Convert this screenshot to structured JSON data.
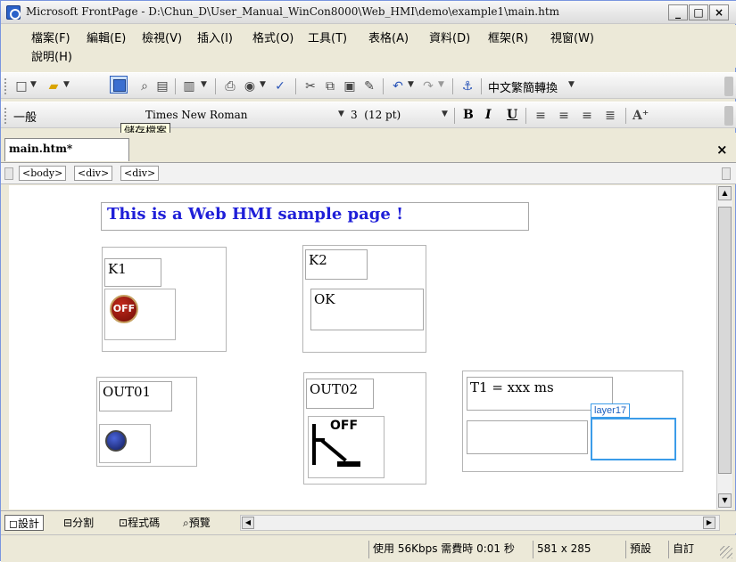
{
  "window": {
    "title": "Microsoft FrontPage - D:\\Chun_D\\User_Manual_WinCon8000\\Web_HMI\\demo\\example1\\main.htm",
    "controls": [
      "_",
      "□",
      "×"
    ]
  },
  "menu": {
    "items": [
      "檔案(F)",
      "編輯(E)",
      "檢視(V)",
      "插入(I)",
      "格式(O)",
      "工具(T)",
      "表格(A)",
      "資料(D)",
      "框架(R)",
      "視窗(W)",
      "說明(H)"
    ]
  },
  "toolbar_standard": {
    "convert_label": "中文繁簡轉換",
    "tooltip": "儲存檔案"
  },
  "toolbar_format": {
    "style": "一般",
    "font": "Times New Roman",
    "size": "3  (12 pt)",
    "bold": "B",
    "italic": "I",
    "underline": "U"
  },
  "doc_tabs": {
    "active": "main.htm*",
    "close": "×"
  },
  "tag_path": [
    "<body>",
    "<div>",
    "<div>"
  ],
  "design": {
    "heading": "This is a Web HMI sample page !",
    "k1_label": "K1",
    "k1_button_text": "OFF",
    "k2_label": "K2",
    "k2_value": "OK",
    "out01_label": "OUT01",
    "out02_label": "OUT02",
    "out02_switch_text": "OFF",
    "t1_label": "T1 = xxx ms",
    "layer_label": "layer17"
  },
  "view_tabs": [
    "設計",
    "分割",
    "程式碼",
    "預覽"
  ],
  "status": {
    "download_time": "使用 56Kbps 需費時 0:01 秒",
    "page_size": "581 x 285",
    "schema": "預設",
    "css": "自訂"
  },
  "colors": {
    "heading_blue": "#1f1fd8",
    "layer_blue": "#3b9ce9",
    "off_red": "#8b0f06",
    "led_blue": "#1c2b8c"
  }
}
